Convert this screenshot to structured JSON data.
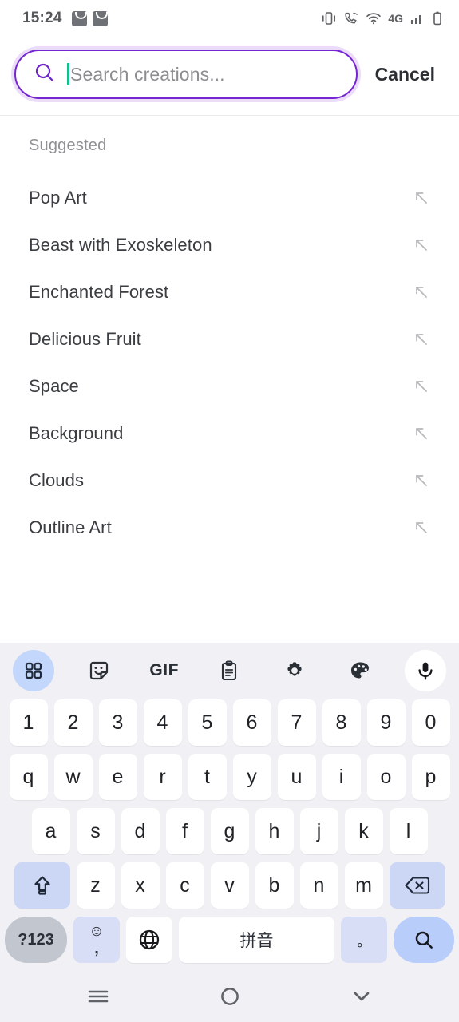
{
  "status_bar": {
    "time": "15:24",
    "left_icons": [
      "app-bag-icon",
      "app-bag-icon"
    ],
    "network_label": "4G",
    "right_icons": [
      "vibrate-icon",
      "wifi-calling-icon",
      "wifi-icon",
      "signal-bars-icon",
      "battery-icon"
    ]
  },
  "search": {
    "placeholder": "Search creations...",
    "value": "",
    "cancel_label": "Cancel",
    "icon": "search-icon",
    "border_color": "#7626d1",
    "caret_color": "#13c08a"
  },
  "suggestions": {
    "title": "Suggested",
    "items": [
      {
        "label": "Pop Art",
        "action_icon": "arrow-up-left-icon"
      },
      {
        "label": "Beast with Exoskeleton",
        "action_icon": "arrow-up-left-icon"
      },
      {
        "label": "Enchanted Forest",
        "action_icon": "arrow-up-left-icon"
      },
      {
        "label": "Delicious Fruit",
        "action_icon": "arrow-up-left-icon"
      },
      {
        "label": "Space",
        "action_icon": "arrow-up-left-icon"
      },
      {
        "label": "Background",
        "action_icon": "arrow-up-left-icon"
      },
      {
        "label": "Clouds",
        "action_icon": "arrow-up-left-icon"
      },
      {
        "label": "Outline Art",
        "action_icon": "arrow-up-left-icon"
      }
    ]
  },
  "keyboard": {
    "toolbar": [
      {
        "name": "grid-icon",
        "label": ""
      },
      {
        "name": "sticker-icon",
        "label": ""
      },
      {
        "name": "gif-icon",
        "label": "GIF"
      },
      {
        "name": "clipboard-icon",
        "label": ""
      },
      {
        "name": "gear-icon",
        "label": ""
      },
      {
        "name": "palette-icon",
        "label": ""
      },
      {
        "name": "microphone-icon",
        "label": ""
      }
    ],
    "row_numbers": [
      "1",
      "2",
      "3",
      "4",
      "5",
      "6",
      "7",
      "8",
      "9",
      "0"
    ],
    "row_q": [
      "q",
      "w",
      "e",
      "r",
      "t",
      "y",
      "u",
      "i",
      "o",
      "p"
    ],
    "row_a": [
      "a",
      "s",
      "d",
      "f",
      "g",
      "h",
      "j",
      "k",
      "l"
    ],
    "row_z": [
      "z",
      "x",
      "c",
      "v",
      "b",
      "n",
      "m"
    ],
    "shift_key": "shift-icon",
    "backspace_key": "backspace-icon",
    "symbols_key": "?123",
    "emoji_key_top": "☺",
    "emoji_key_bottom": ",",
    "globe_key": "globe-icon",
    "space_key": "拼音",
    "period_key": "。",
    "enter_key": "search-icon",
    "key_bg": "#ffffff",
    "mod_key_bg": "#ccd6f5",
    "keyboard_bg": "#f1f1f5"
  },
  "nav_bar": {
    "recents": "menu-icon",
    "home": "home-circle-icon",
    "back": "chevron-down-icon"
  }
}
